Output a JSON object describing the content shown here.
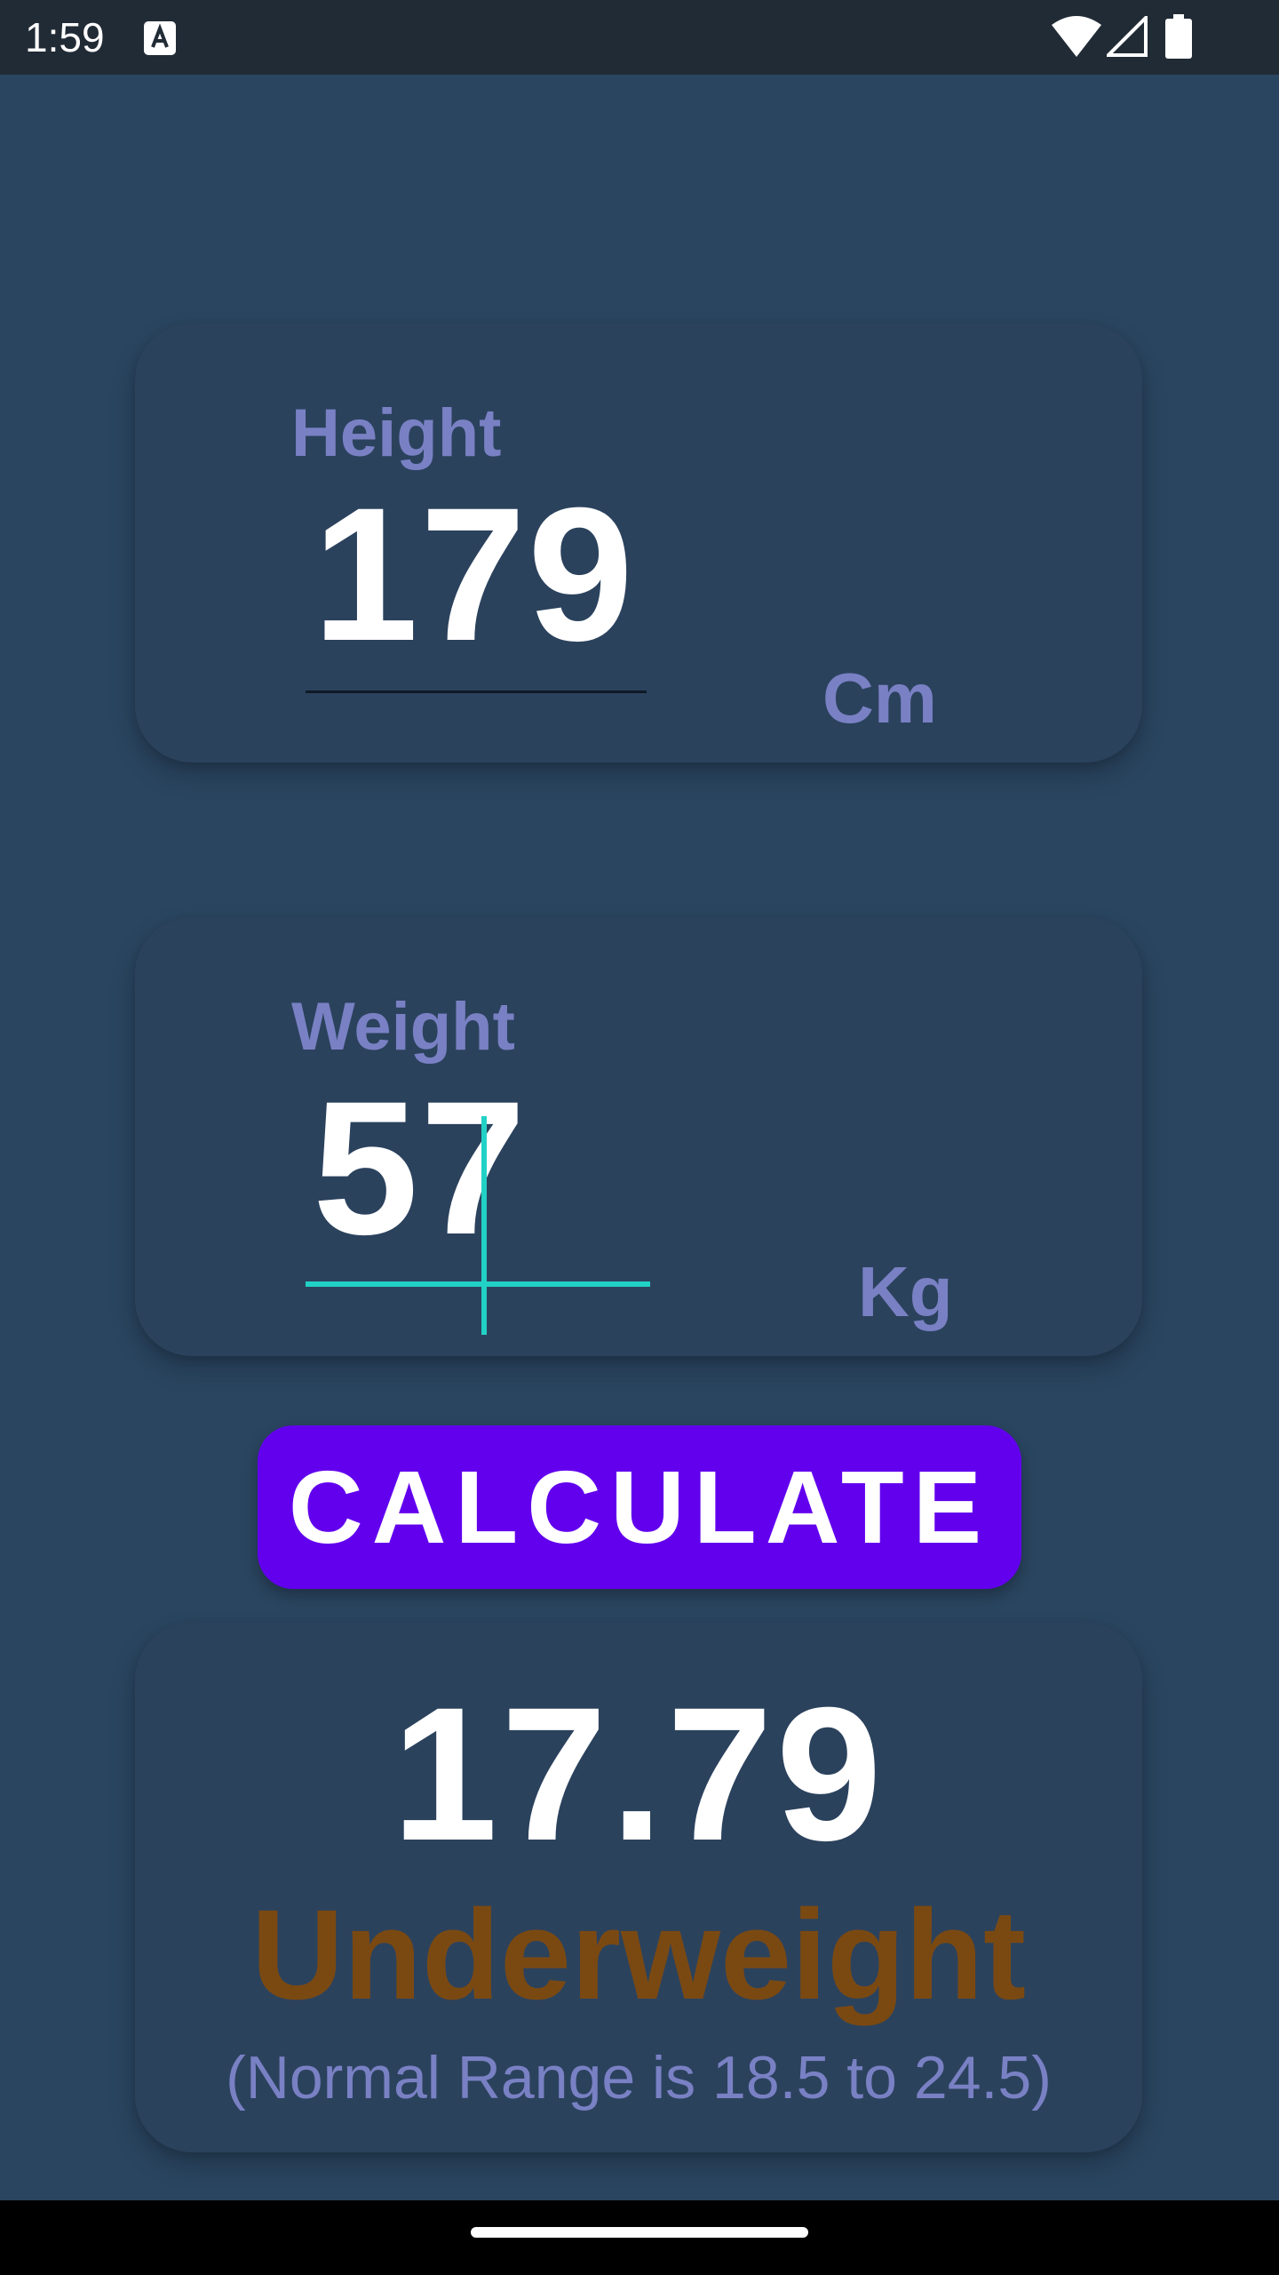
{
  "status_bar": {
    "time": "1:59",
    "icons": [
      "text-a-icon",
      "wifi-icon",
      "signal-icon",
      "battery-icon"
    ]
  },
  "height_card": {
    "label": "Height",
    "value": "179",
    "unit": "Cm"
  },
  "weight_card": {
    "label": "Weight",
    "value": "57",
    "unit": "Kg",
    "focused": true
  },
  "calculate_button": {
    "label": "CALCULATE"
  },
  "result_card": {
    "bmi": "17.79",
    "category": "Underweight",
    "range_text": "(Normal Range is 18.5 to 24.5)"
  },
  "colors": {
    "background": "#2a4560",
    "card": "#2b425d",
    "label": "#7981c4",
    "accent_focus": "#22d1c6",
    "button": "#6200ee",
    "category_underweight": "#7a4912"
  }
}
